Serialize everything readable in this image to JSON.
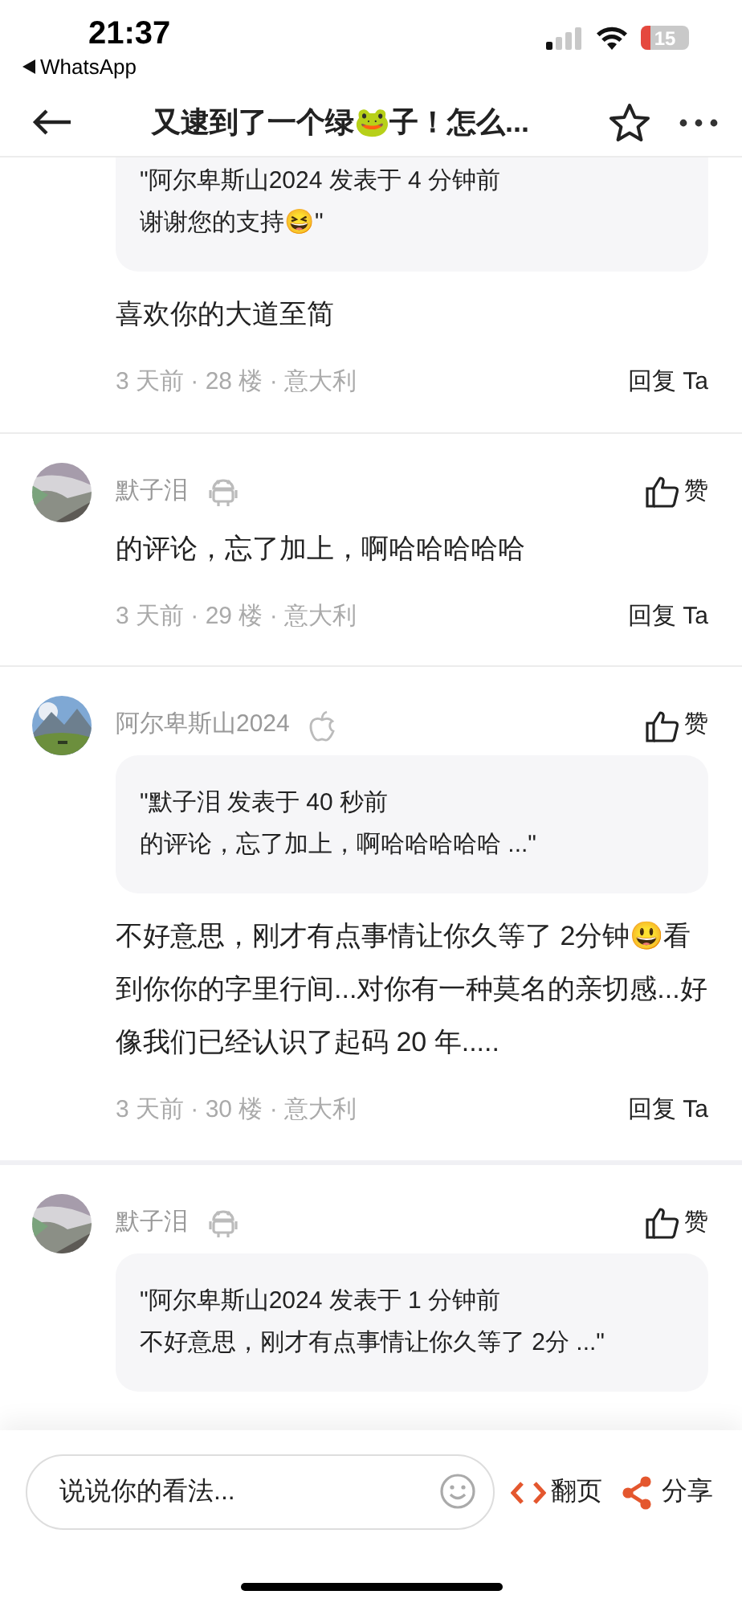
{
  "status_bar": {
    "time": "21:37",
    "back_app": "WhatsApp",
    "battery": "15"
  },
  "nav": {
    "title": "又逮到了一个绿🐸子！怎么..."
  },
  "comments": [
    {
      "quote": [
        "\"阿尔卑斯山2024 发表于 4 分钟前",
        "谢谢您的支持😆\""
      ],
      "body": "喜欢你的大道至简",
      "meta": "3 天前 · 28 楼 · 意大利",
      "reply": "回复 Ta"
    },
    {
      "author": "默子泪",
      "kind": "android",
      "like": "赞",
      "body": "的评论，忘了加上，啊哈哈哈哈哈",
      "meta": "3 天前 · 29 楼 · 意大利",
      "reply": "回复 Ta"
    },
    {
      "author": "阿尔卑斯山2024",
      "kind": "apple",
      "like": "赞",
      "quote": [
        "\"默子泪 发表于 40 秒前",
        "的评论，忘了加上，啊哈哈哈哈哈 ...\""
      ],
      "body": "不好意思，刚才有点事情让你久等了 2分钟😃看到你你的字里行间...对你有一种莫名的亲切感...好像我们已经认识了起码 20 年.....",
      "meta": "3 天前 · 30 楼 · 意大利",
      "reply": "回复 Ta"
    },
    {
      "author": "默子泪",
      "kind": "android",
      "like": "赞",
      "quote": [
        "\"阿尔卑斯山2024 发表于 1 分钟前",
        "不好意思，刚才有点事情让你久等了 2分 ...\""
      ]
    }
  ],
  "bottom_bar": {
    "input": {
      "placeholder": "说说你的看法..."
    },
    "page_button": "翻页",
    "share_button": "分享"
  }
}
